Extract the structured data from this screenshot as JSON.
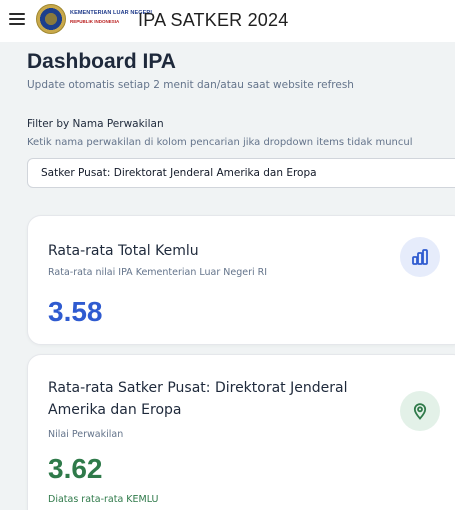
{
  "header": {
    "logo_line1": "KEMENTERIAN LUAR NEGERI",
    "logo_line2": "REPUBLIK INDONESIA",
    "app_title": "IPA SATKER 2024"
  },
  "dashboard": {
    "title": "Dashboard IPA",
    "subtitle": "Update otomatis setiap 2 menit dan/atau saat website refresh"
  },
  "filter": {
    "label": "Filter by Nama Perwakilan",
    "hint": "Ketik nama perwakilan di kolom pencarian jika dropdown items tidak muncul",
    "selected": "Satker Pusat: Direktorat Jenderal Amerika dan Eropa"
  },
  "cards": [
    {
      "title": "Rata-rata Total Kemlu",
      "description": "Rata-rata nilai IPA Kementerian Luar Negeri RI",
      "value": "3.58",
      "icon": "bar-chart-icon",
      "accent": "#2f5bd0"
    },
    {
      "title": "Rata-rata Satker Pusat: Direktorat Jenderal Amerika dan Eropa",
      "description": "Nilai Perwakilan",
      "value": "3.62",
      "note": "Diatas rata-rata KEMLU",
      "icon": "map-pin-icon",
      "accent": "#2f7a4a"
    }
  ]
}
